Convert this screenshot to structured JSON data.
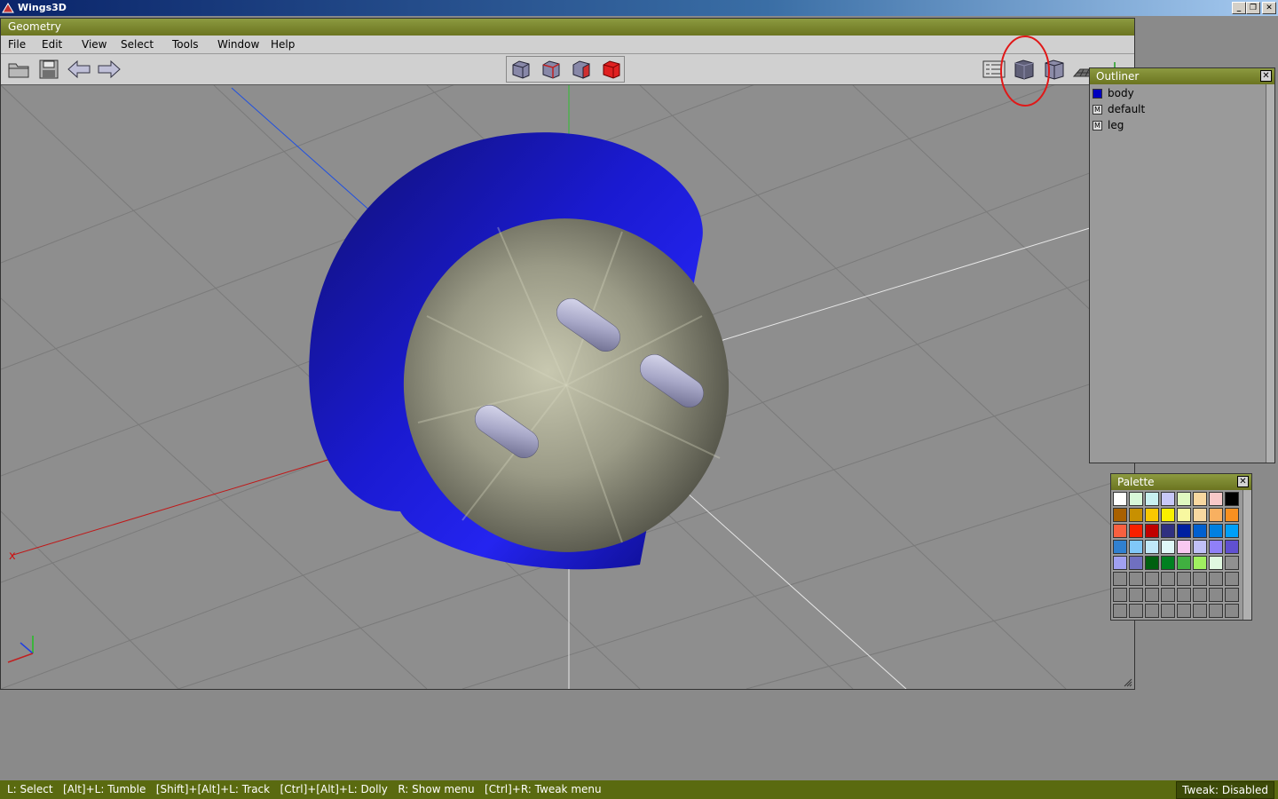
{
  "app": {
    "title": "Wings3D"
  },
  "window_buttons": {
    "minimize": "_",
    "restore": "❐",
    "close": "✕"
  },
  "geometry": {
    "title": "Geometry"
  },
  "menu": [
    "File",
    "Edit",
    "View",
    "Select",
    "Tools",
    "Window",
    "Help"
  ],
  "toolbar": {
    "left_icons": [
      "open-folder-icon",
      "save-icon",
      "undo-arrow-icon",
      "redo-arrow-icon"
    ],
    "selection_modes": [
      "vertex-select-icon",
      "edge-select-icon",
      "face-select-icon",
      "body-select-icon"
    ],
    "view_modes": [
      "outliner-toggle-icon",
      "smooth-shaded-icon",
      "wireframe-shaded-icon",
      "groundplane-icon",
      "axes-icon"
    ]
  },
  "axes": {
    "x_label": "x"
  },
  "outliner": {
    "title": "Outliner",
    "items": [
      {
        "label": "body",
        "color": "#0000c0",
        "marker": ""
      },
      {
        "label": "default",
        "color": "#e0e0e0",
        "marker": "M"
      },
      {
        "label": "leg",
        "color": "#e0e0e0",
        "marker": "M"
      }
    ]
  },
  "palette": {
    "title": "Palette",
    "colors": [
      "#ffffff",
      "#d8f8d8",
      "#c8f0f0",
      "#c8c8f8",
      "#e0f8c0",
      "#f8d8a0",
      "#f8c8c8",
      "#000000",
      "#a86000",
      "#c89000",
      "#f8c800",
      "#f8f000",
      "#f8f8a0",
      "#f8d8a0",
      "#f8b060",
      "#f89020",
      "#f86040",
      "#f82000",
      "#c00000",
      "#303080",
      "#0020a0",
      "#0060d0",
      "#0080e0",
      "#00a0f8",
      "#3080d0",
      "#80c8f8",
      "#c0e8f8",
      "#e0f8f8",
      "#f8c8f0",
      "#c0c0f8",
      "#9080f8",
      "#6050d0",
      "#a0a0f0",
      "#7070c0",
      "#006010",
      "#008020",
      "#40b040",
      "#a0f060",
      "#e0f8e0",
      "#909090",
      "#8a8a8a",
      "#8a8a8a",
      "#8a8a8a",
      "#8a8a8a",
      "#8a8a8a",
      "#8a8a8a",
      "#8a8a8a",
      "#8a8a8a",
      "#8a8a8a",
      "#8a8a8a",
      "#8a8a8a",
      "#8a8a8a",
      "#8a8a8a",
      "#8a8a8a",
      "#8a8a8a",
      "#8a8a8a",
      "#8a8a8a",
      "#8a8a8a",
      "#8a8a8a",
      "#8a8a8a",
      "#8a8a8a",
      "#8a8a8a",
      "#8a8a8a",
      "#8a8a8a"
    ]
  },
  "status": {
    "help": "L: Select   [Alt]+L: Tumble   [Shift]+[Alt]+L: Track   [Ctrl]+[Alt]+L: Dolly   R: Show menu   [Ctrl]+R: Tweak menu",
    "tweak": "Tweak: Disabled"
  }
}
